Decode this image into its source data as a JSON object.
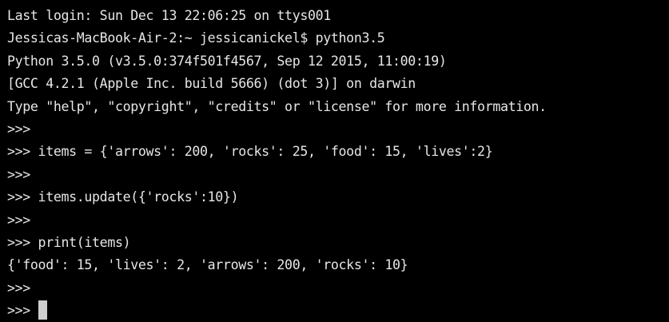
{
  "terminal": {
    "lines": [
      "Last login: Sun Dec 13 22:06:25 on ttys001",
      "Jessicas-MacBook-Air-2:~ jessicanickel$ python3.5",
      "Python 3.5.0 (v3.5.0:374f501f4567, Sep 12 2015, 11:00:19)",
      "[GCC 4.2.1 (Apple Inc. build 5666) (dot 3)] on darwin",
      "Type \"help\", \"copyright\", \"credits\" or \"license\" for more information.",
      ">>>",
      ">>> items = {'arrows': 200, 'rocks': 25, 'food': 15, 'lives':2}",
      ">>>",
      ">>> items.update({'rocks':10})",
      ">>>",
      ">>> print(items)",
      "{'food': 15, 'lives': 2, 'arrows': 200, 'rocks': 10}",
      ">>>"
    ],
    "active_prompt": ">>> "
  }
}
